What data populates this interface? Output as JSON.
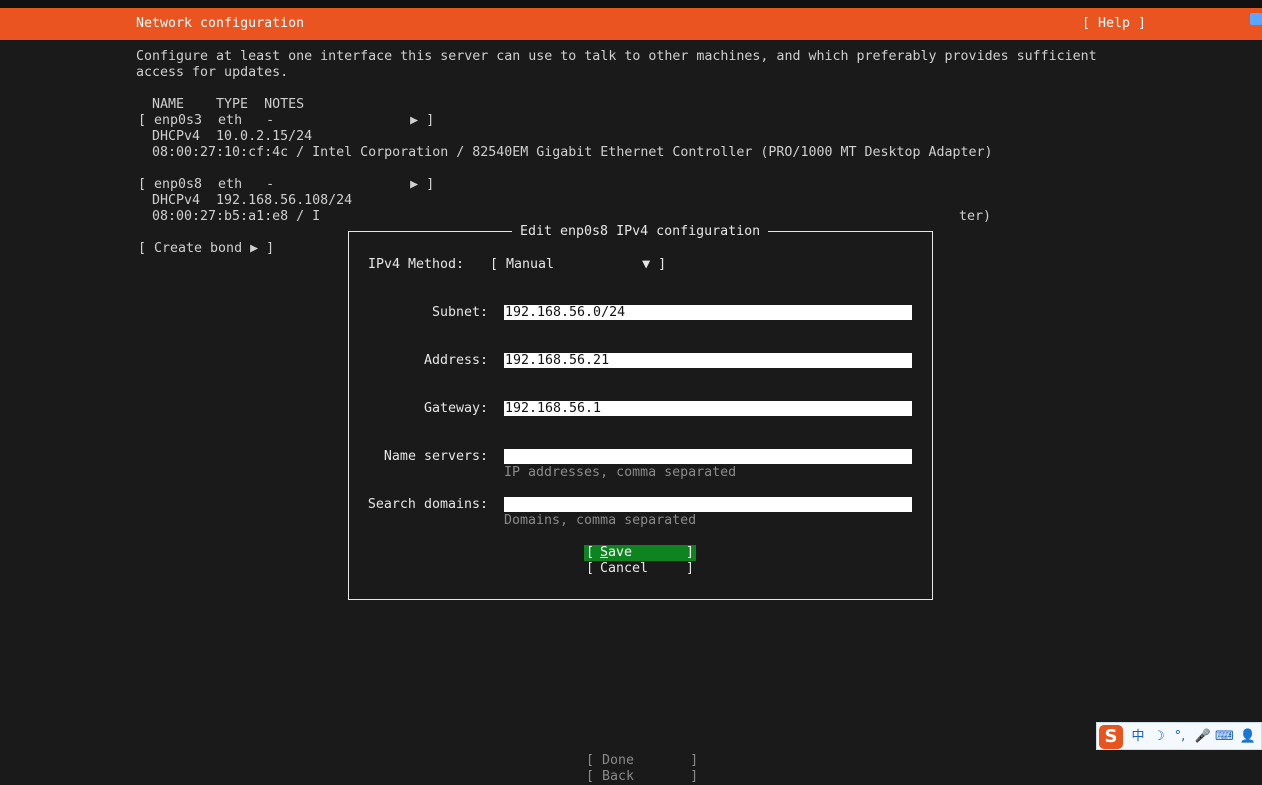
{
  "header": {
    "title": "Network configuration",
    "help": "[ Help ]"
  },
  "intro": {
    "line1": "Configure at least one interface this server can use to talk to other machines, and which preferably provides sufficient",
    "line2": "access for updates."
  },
  "table": {
    "columns": "NAME    TYPE  NOTES",
    "interfaces": [
      {
        "row": "[ enp0s3  eth   -                 ▶ ]",
        "proto": "DHCPv4  10.0.2.15/24",
        "hw": "08:00:27:10:cf:4c / Intel Corporation / 82540EM Gigabit Ethernet Controller (PRO/1000 MT Desktop Adapter)"
      },
      {
        "row": "[ enp0s8  eth   -                 ▶ ]",
        "proto": "DHCPv4  192.168.56.108/24",
        "hw_left": "08:00:27:b5:a1:e8 / I",
        "hw_right": "ter)"
      }
    ]
  },
  "create_bond": "[ Create bond ▶ ]",
  "dialog": {
    "title": "Edit enp0s8 IPv4 configuration",
    "method_label": "IPv4 Method:",
    "method_value": "[ Manual           ▼ ]",
    "subnet_label": "Subnet:",
    "subnet_value": "192.168.56.0/24",
    "address_label": "Address:",
    "address_value": "192.168.56.21",
    "gateway_label": "Gateway:",
    "gateway_value": "192.168.56.1",
    "nameservers_label": "Name servers:",
    "nameservers_value": "",
    "nameservers_hint": "IP addresses, comma separated",
    "searchdomains_label": "Search domains:",
    "searchdomains_value": "",
    "searchdomains_hint": "Domains, comma separated",
    "save_bracket_l": "[",
    "save_label_first": "S",
    "save_label_rest": "ave",
    "save_bracket_r": "]",
    "cancel_bracket_l": "[",
    "cancel_label": "Cancel",
    "cancel_bracket_r": "]"
  },
  "footer": {
    "done": "[ Done       ]",
    "back": "[ Back       ]"
  },
  "ime": {
    "logo": "S",
    "items": [
      "中",
      "☽",
      "°,",
      "🎤",
      "⌨",
      "👤"
    ]
  },
  "colors": {
    "header": "#e95420",
    "save_focus": "#0e8420",
    "background": "#1a1a1a"
  }
}
